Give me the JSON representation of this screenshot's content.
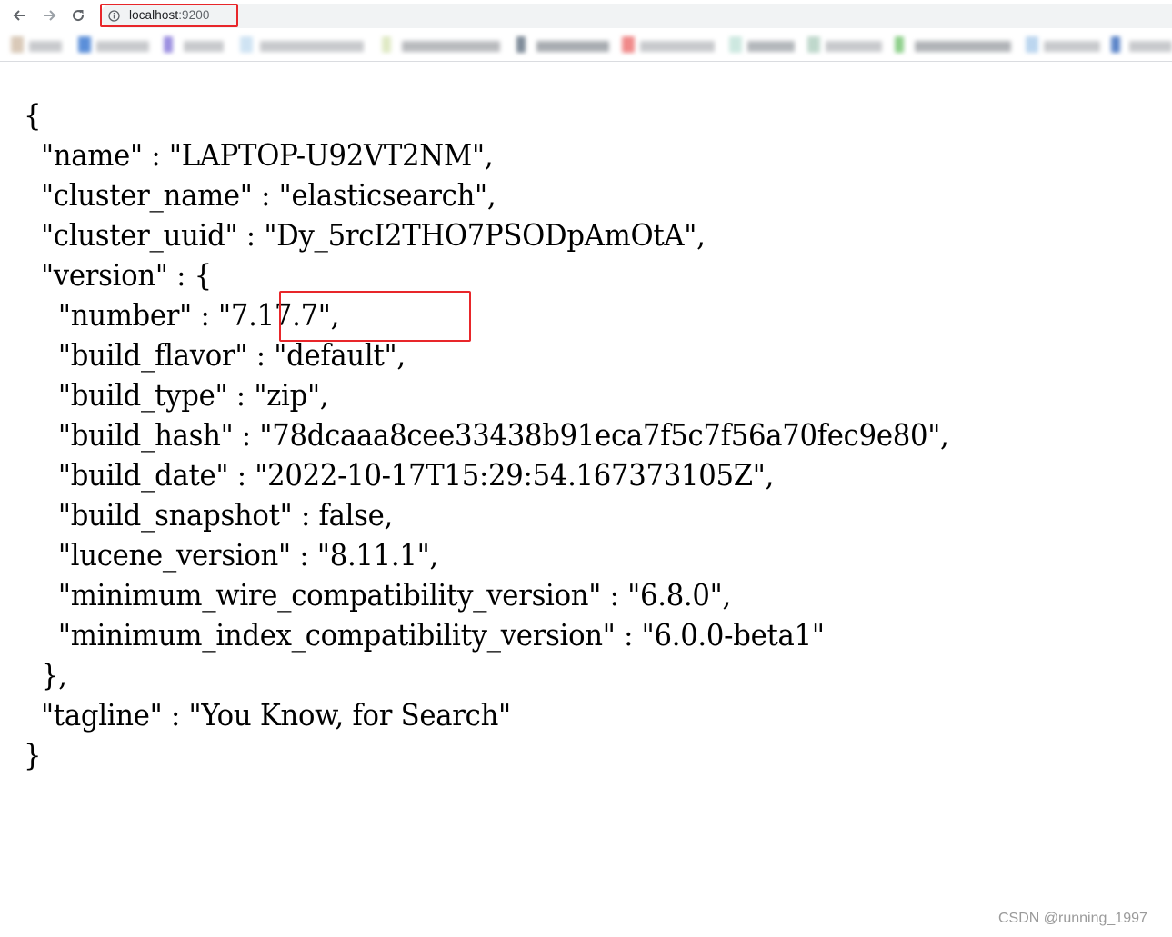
{
  "browser": {
    "url_host": "localhost",
    "url_port": ":9200",
    "icons": {
      "back": "arrow-left-icon",
      "forward": "arrow-right-icon",
      "reload": "reload-icon",
      "info": "info-icon"
    },
    "colors": {
      "highlight": "#e8262a",
      "address_bar_bg": "#f1f3f4"
    }
  },
  "response": {
    "open_brace": "{",
    "name_line": "  \"name\" : \"LAPTOP-U92VT2NM\",",
    "cluster_name_line": "  \"cluster_name\" : \"elasticsearch\",",
    "cluster_uuid_line": "  \"cluster_uuid\" : \"Dy_5rcI2THO7PSODpAmOtA\",",
    "version_open_line": "  \"version\" : {",
    "number_line": "    \"number\" : \"7.17.7\",",
    "build_flavor_line": "    \"build_flavor\" : \"default\",",
    "build_type_line": "    \"build_type\" : \"zip\",",
    "build_hash_line": "    \"build_hash\" : \"78dcaaa8cee33438b91eca7f5c7f56a70fec9e80\",",
    "build_date_line": "    \"build_date\" : \"2022-10-17T15:29:54.167373105Z\",",
    "build_snapshot_line": "    \"build_snapshot\" : false,",
    "lucene_version_line": "    \"lucene_version\" : \"8.11.1\",",
    "min_wire_line": "    \"minimum_wire_compatibility_version\" : \"6.8.0\",",
    "min_index_line": "    \"minimum_index_compatibility_version\" : \"6.0.0-beta1\"",
    "version_close_line": "  },",
    "tagline_line": "  \"tagline\" : \"You Know, for Search\"",
    "close_brace": "}"
  },
  "watermark": "CSDN @running_1997"
}
